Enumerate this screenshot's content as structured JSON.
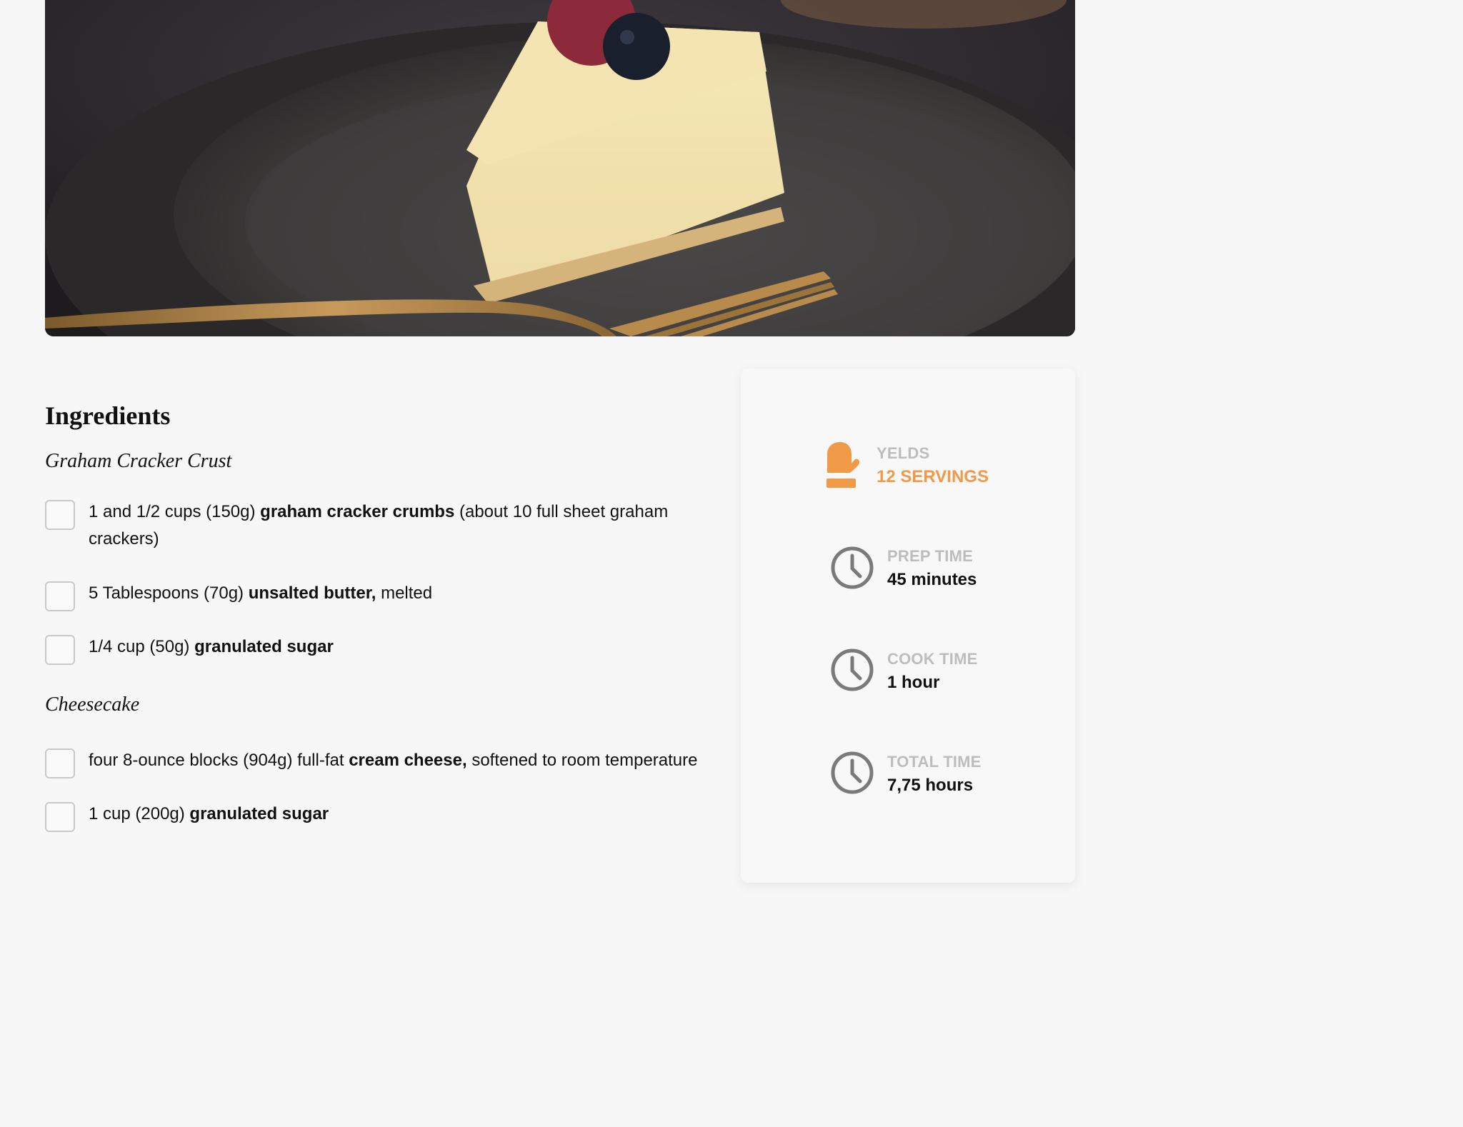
{
  "hero": {
    "alt": "Slice of cheesecake with raspberry and blueberry on a dark plate with a gold fork"
  },
  "ingredients": {
    "heading": "Ingredients",
    "sections": [
      {
        "title": "Graham Cracker Crust",
        "items": [
          {
            "pre": "1 and 1/2 cups (150g) ",
            "bold": "graham cracker crumbs",
            "post": " (about 10 full sheet graham crackers)"
          },
          {
            "pre": "5 Tablespoons (70g) ",
            "bold": "unsalted butter,",
            "post": " melted"
          },
          {
            "pre": "1/4 cup (50g) ",
            "bold": "granulated sugar",
            "post": ""
          }
        ]
      },
      {
        "title": "Cheesecake",
        "items": [
          {
            "pre": "four 8-ounce blocks (904g) full-fat ",
            "bold": "cream cheese,",
            "post": " softened to room temperature"
          },
          {
            "pre": "1 cup (200g) ",
            "bold": "granulated sugar",
            "post": ""
          }
        ]
      }
    ]
  },
  "info": {
    "yields": {
      "label": "YELDS",
      "value": "12 SERVINGS",
      "icon": "oven-mitt-icon"
    },
    "prep": {
      "label": "PREP TIME",
      "value": "45 minutes",
      "icon": "clock-icon"
    },
    "cook": {
      "label": "COOK TIME",
      "value": "1 hour",
      "icon": "clock-icon"
    },
    "total": {
      "label": "TOTAL TIME",
      "value": "7,75 hours",
      "icon": "clock-icon"
    }
  },
  "colors": {
    "accent": "#f09a48",
    "muted": "#bdbdbd",
    "icon_gray": "#7a7a7a"
  }
}
